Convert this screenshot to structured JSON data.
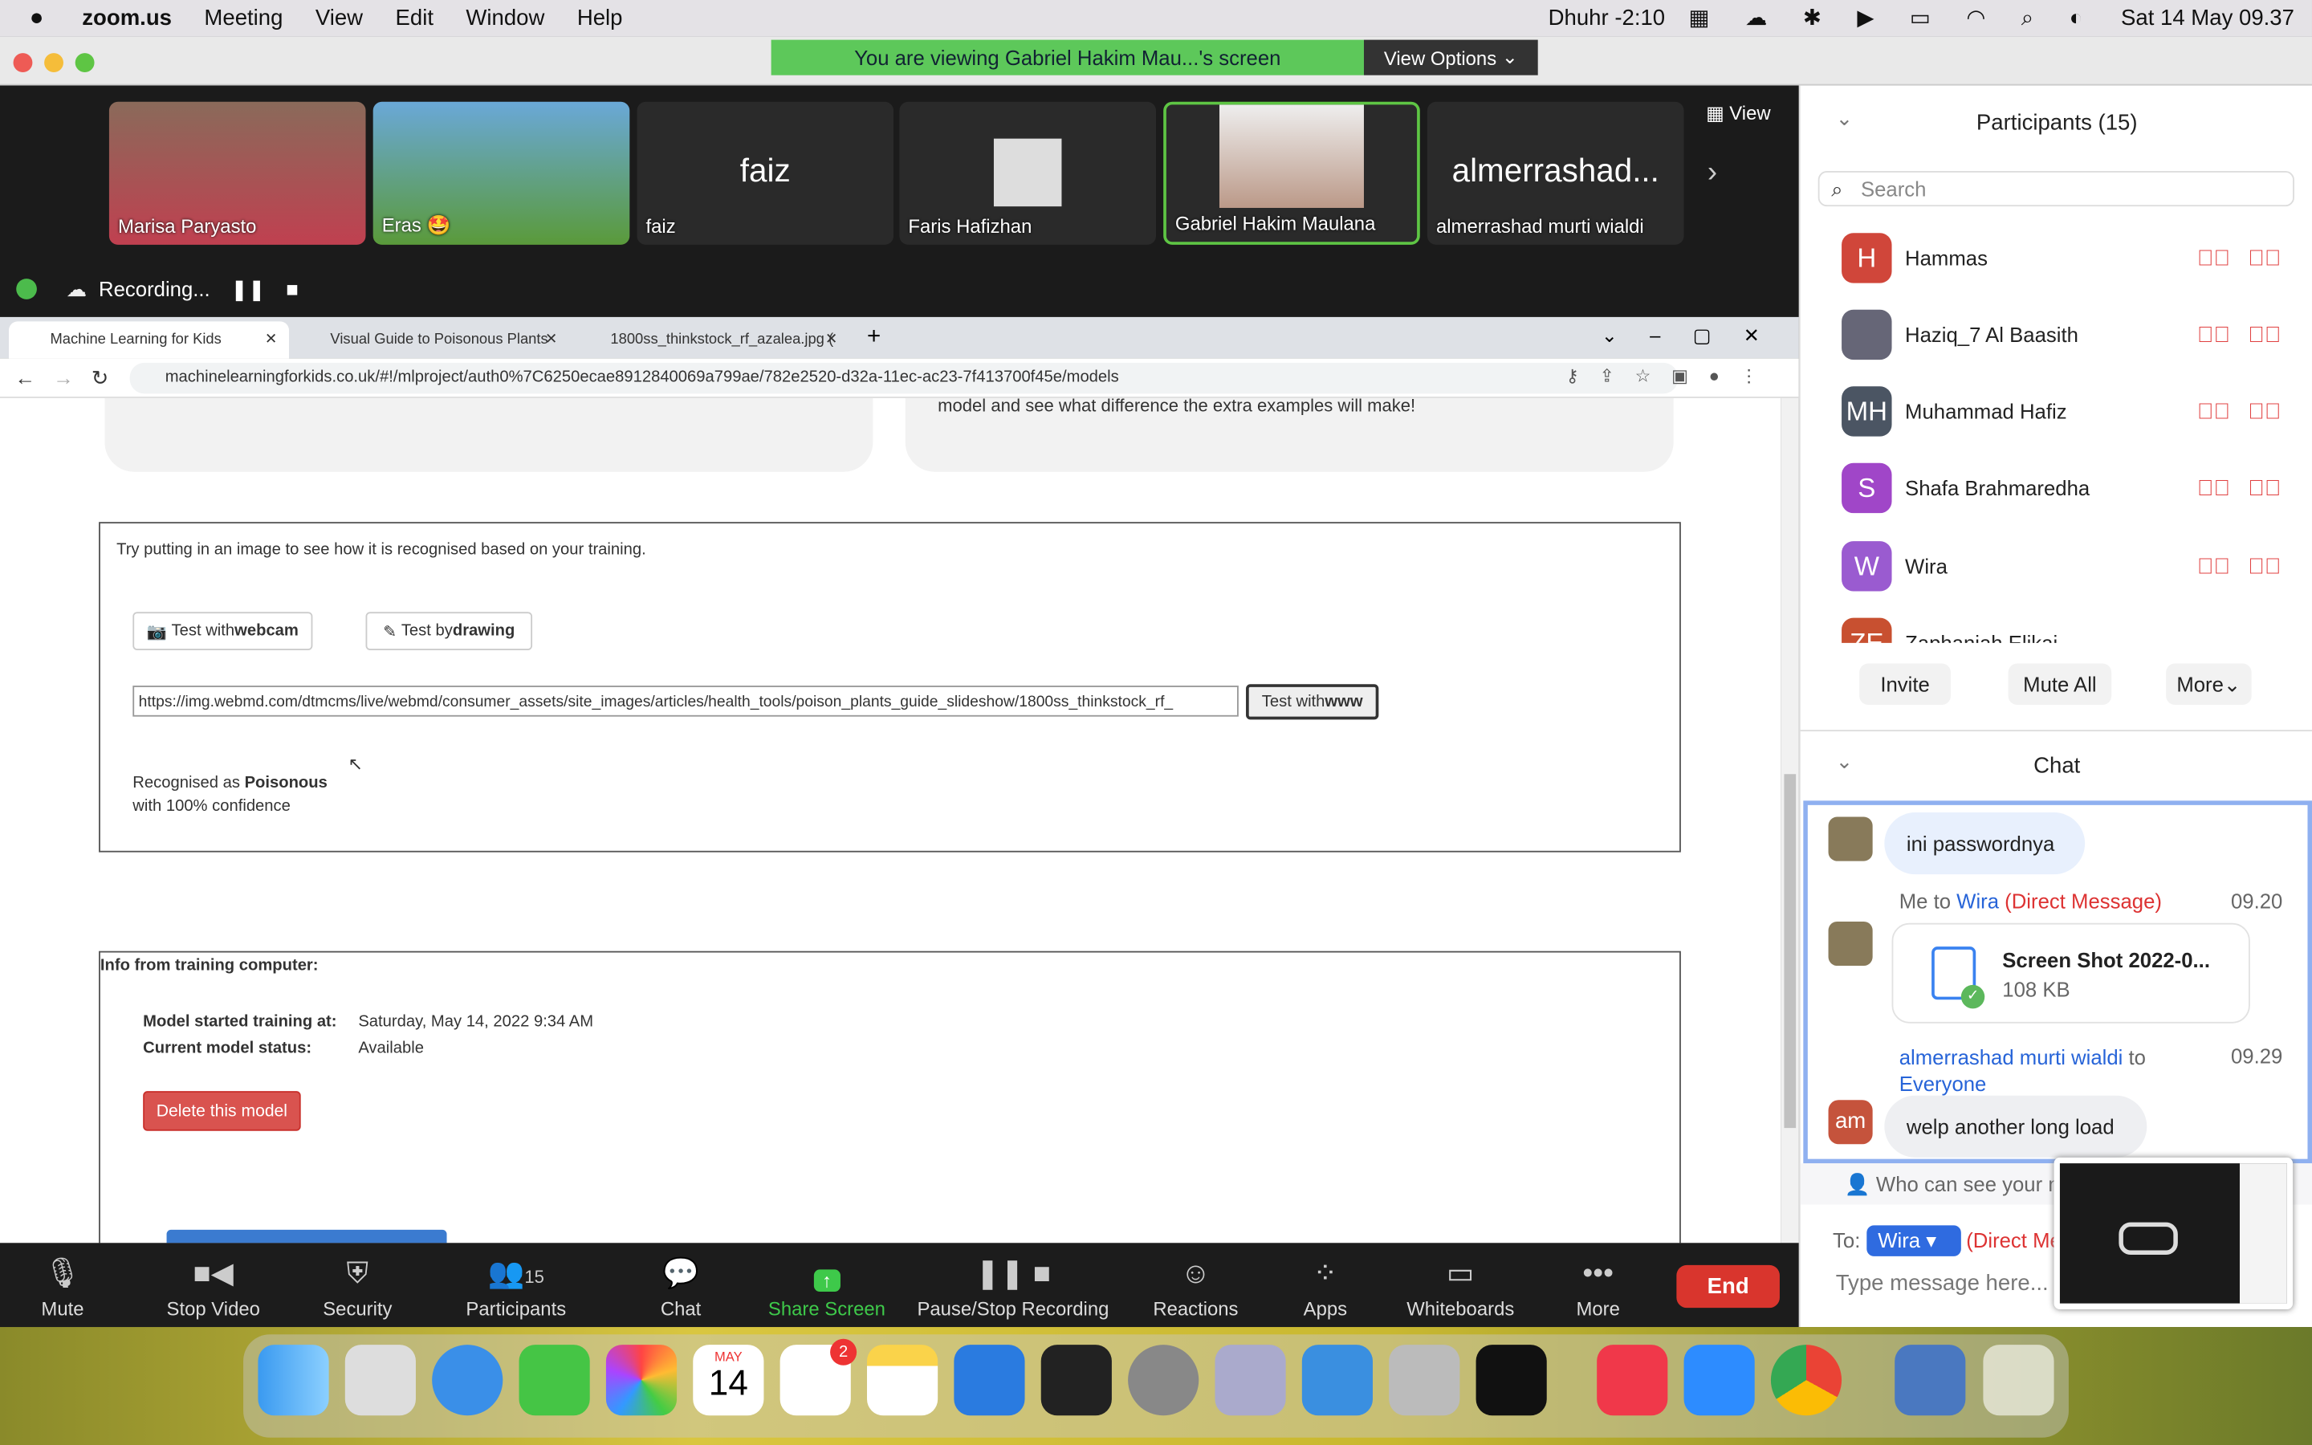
{
  "menubar": {
    "app": "zoom.us",
    "items": [
      "Meeting",
      "View",
      "Edit",
      "Window",
      "Help"
    ],
    "prayer": "Dhuhr -2:10",
    "datetime": "Sat 14 May  09.37"
  },
  "banner": {
    "text": "You are viewing Gabriel Hakim Mau...'s screen",
    "view_options": "View Options"
  },
  "videos": [
    {
      "name": "Marisa Paryasto",
      "big": ""
    },
    {
      "name": "Eras 🤩",
      "big": ""
    },
    {
      "name": "faiz",
      "big": "faiz"
    },
    {
      "name": "Faris Hafizhan",
      "big": ""
    },
    {
      "name": "Gabriel Hakim Maulana",
      "big": ""
    },
    {
      "name": "almerrashad murti wialdi",
      "big": "almerrashad..."
    }
  ],
  "view_label": "View",
  "recording": {
    "label": "Recording..."
  },
  "browser": {
    "tabs": [
      "Machine Learning for Kids",
      "Visual Guide to Poisonous Plants",
      "1800ss_thinkstock_rf_azalea.jpg ("
    ],
    "url": "machinelearningforkids.co.uk/#!/mlproject/auth0%7C6250ecae8912840069a799ae/782e2520-d32a-11ec-ac23-7f413700f45e/models"
  },
  "page": {
    "top_text": "model and see what difference the extra examples will make!",
    "try_text": "Try putting in an image to see how it is recognised based on your training.",
    "webcam_prefix": "Test with ",
    "webcam_bold": "webcam",
    "drawing_prefix": "Test by ",
    "drawing_bold": "drawing",
    "url_value": "https://img.webmd.com/dtmcms/live/webmd/consumer_assets/site_images/articles/health_tools/poison_plants_guide_slideshow/1800ss_thinkstock_rf_",
    "www_prefix": "Test with ",
    "www_bold": "www",
    "recognised_prefix": "Recognised as ",
    "recognised_label": "Poisonous",
    "confidence": "with 100% confidence",
    "info_title": "Info from training computer:",
    "started_label": "Model started training at:",
    "started_value": "Saturday, May 14, 2022 9:34 AM",
    "status_label": "Current model status:",
    "status_value": "Available",
    "delete_label": "Delete this model"
  },
  "toolbar": {
    "mute": "Mute",
    "video": "Stop Video",
    "security": "Security",
    "participants": "Participants",
    "participants_count": "15",
    "chat": "Chat",
    "share": "Share Screen",
    "record": "Pause/Stop Recording",
    "reactions": "Reactions",
    "apps": "Apps",
    "whiteboards": "Whiteboards",
    "more": "More",
    "end": "End"
  },
  "participants": {
    "title": "Participants (15)",
    "search_placeholder": "Search",
    "list": [
      {
        "initials": "H",
        "name": "Hammas",
        "color": "#d0463a"
      },
      {
        "initials": "",
        "name": "Haziq_7 Al Baasith",
        "color": "#556"
      },
      {
        "initials": "MH",
        "name": "Muhammad Hafiz",
        "color": "#4b5563"
      },
      {
        "initials": "S",
        "name": "Shafa Brahmaredha",
        "color": "#a046c8"
      },
      {
        "initials": "W",
        "name": "Wira",
        "color": "#9a5bd0"
      },
      {
        "initials": "ZE",
        "name": "Zaphaniah Elikai",
        "color": "#c85030"
      }
    ],
    "invite": "Invite",
    "mute_all": "Mute All",
    "more": "More"
  },
  "chat": {
    "title": "Chat",
    "msg1": "ini passwordnya",
    "meta2_me": "Me to ",
    "meta2_to": "Wira",
    "meta2_dm": "(Direct Message)",
    "time2": "09.20",
    "file_name": "Screen Shot 2022-0...",
    "file_size": "108 KB",
    "meta3_from": "almerrashad murti wialdi",
    "meta3_to": " to ",
    "meta3_everyone": "Everyone",
    "time3": "09.29",
    "av3": "am",
    "msg3": "welp another long load",
    "who_can_see": "Who can see your messages?",
    "to_label": "To:",
    "to_value": "Wira",
    "to_dm": "(Direct Message)",
    "placeholder": "Type message here..."
  },
  "dock": {
    "calendar_month": "MAY",
    "calendar_day": "14",
    "reminders_badge": "2"
  }
}
